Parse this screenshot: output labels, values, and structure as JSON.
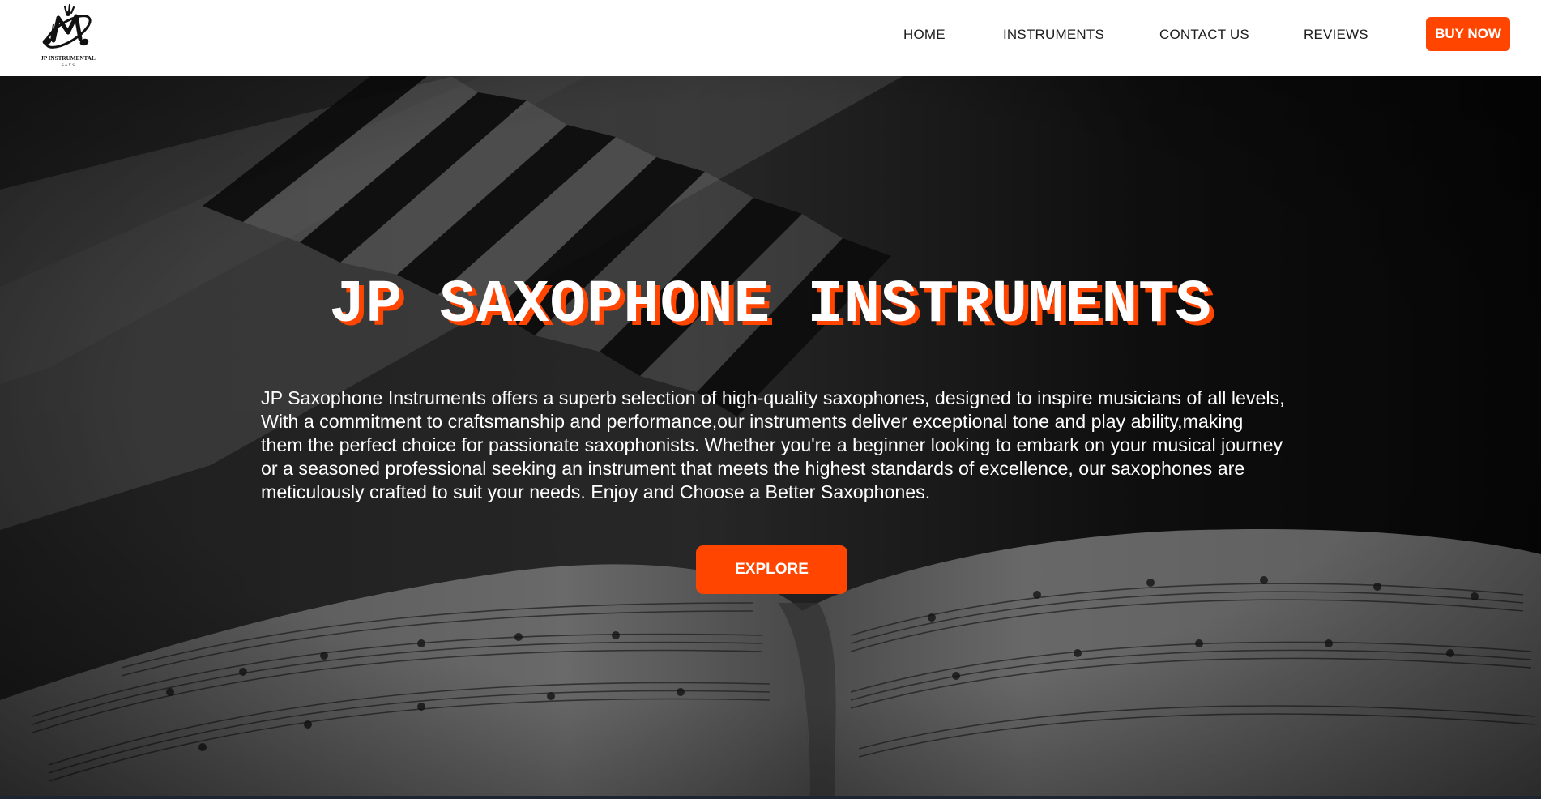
{
  "brand": {
    "logo_icon": "music-notes-logo-icon",
    "logo_text": "JP INSTRUMENTAL",
    "logo_subtext": "S A X S"
  },
  "nav": {
    "home": "HOME",
    "instruments": "INSTRUMENTS",
    "contact": "CONTACT US",
    "reviews": "REVIEWS",
    "buy_now": "BUY NOW"
  },
  "hero": {
    "title": "JP SAXOPHONE INSTRUMENTS",
    "description": "JP Saxophone Instruments offers a superb selection of high-quality saxophones, designed to inspire musicians of all levels, With a commitment to craftsmanship and performance,our instruments deliver exceptional tone and play ability,making them the perfect choice for passionate saxophonists. Whether you're a beginner looking to embark on your musical journey or a seasoned professional seeking an instrument that meets the highest standards of excellence, our saxophones are meticulously crafted to suit your needs. Enjoy and Choose a Better Saxophones.",
    "explore_label": "EXPLORE",
    "background_icon": "piano-and-sheet-music-image"
  },
  "colors": {
    "accent": "#ff4500",
    "header_bg": "#ffffff",
    "nav_text": "#1c1c1c",
    "hero_text": "#ffffff"
  }
}
